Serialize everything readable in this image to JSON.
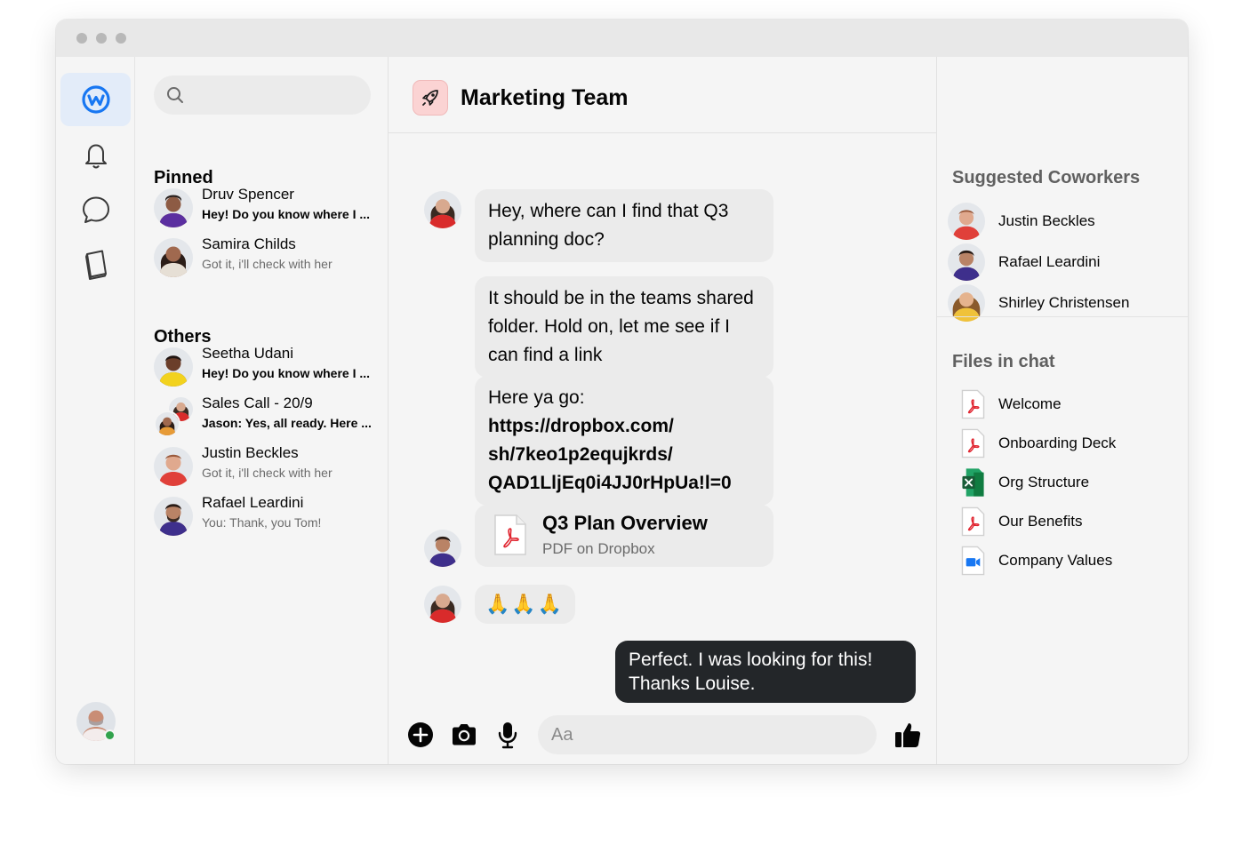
{
  "chat": {
    "title": "Marketing Team",
    "messages": {
      "m1": "Hey, where can I find that Q3 planning doc?",
      "m2": "It should be in the teams shared folder. Hold on, let me see if I can find a link",
      "m3_prefix": "Here ya go:",
      "m3_link": "https://dropbox.com/ sh/7keo1p2equjkrds/ QAD1LljEq0i4JJ0rHpUa!l=0",
      "file_name": "Q3 Plan Overview",
      "file_sub": "PDF on Dropbox",
      "emoji": "🙏🙏🙏",
      "mine": "Perfect. I was looking for this! Thanks Louise."
    },
    "composer_placeholder": "Aa"
  },
  "list": {
    "pinned_title": "Pinned",
    "others_title": "Others",
    "pinned": [
      {
        "name": "Druv Spencer",
        "preview": "Hey! Do you know where I ..."
      },
      {
        "name": "Samira Childs",
        "preview": "Got it, i'll check with her"
      }
    ],
    "others": [
      {
        "name": "Seetha Udani",
        "preview": "Hey! Do you know where I ..."
      },
      {
        "name": "Sales Call - 20/9",
        "preview": "Jason: Yes, all ready. Here ..."
      },
      {
        "name": "Justin Beckles",
        "preview": "Got it, i'll check with her"
      },
      {
        "name": "Rafael Leardini",
        "preview": "You: Thank, you Tom!"
      }
    ]
  },
  "side": {
    "coworkers_title": "Suggested Coworkers",
    "coworkers": [
      "Justin Beckles",
      "Rafael Leardini",
      "Shirley Christensen"
    ],
    "files_title": "Files in chat",
    "files": [
      "Welcome",
      "Onboarding Deck",
      "Org Structure",
      "Our Benefits",
      "Company Values"
    ]
  },
  "icons": {
    "logo": "workplace-logo-icon",
    "notifications": "bell-icon",
    "chat": "chat-bubble-icon",
    "knowledge": "book-icon",
    "search": "search-icon",
    "add": "plus-circle-icon",
    "camera": "camera-icon",
    "mic": "microphone-icon",
    "like": "thumbs-up-icon"
  },
  "colors": {
    "accent": "#1877f2",
    "online": "#31a24c",
    "pdf": "#e0232e",
    "excel": "#1e7145",
    "dark_bubble": "#232629"
  }
}
